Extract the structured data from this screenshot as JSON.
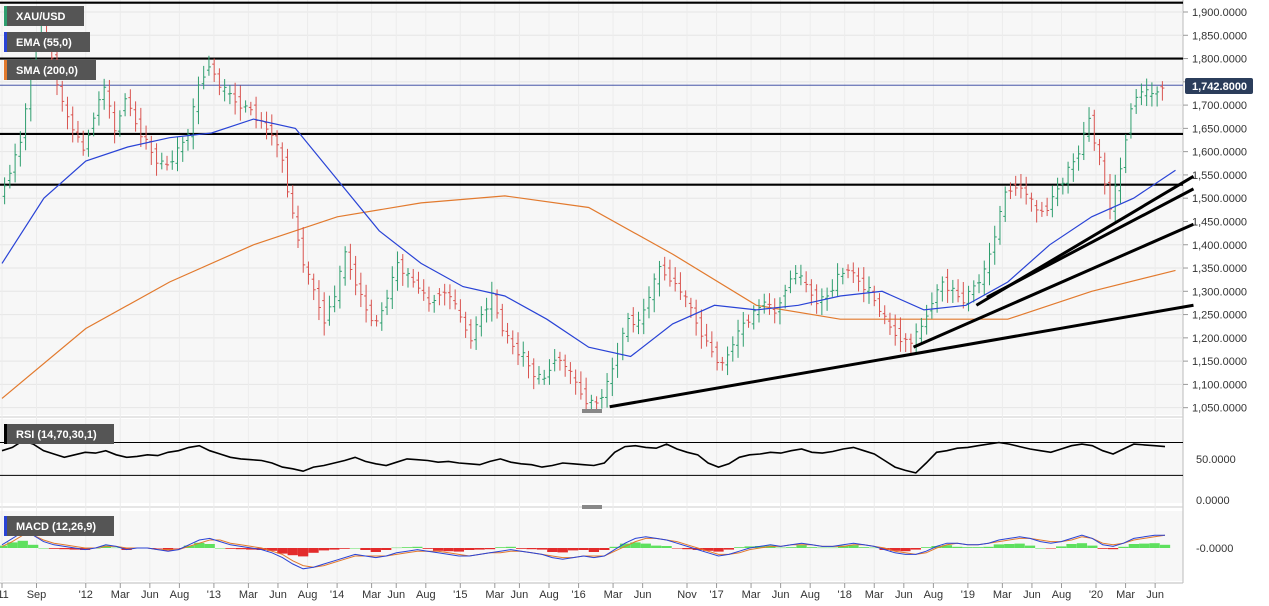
{
  "colors": {
    "up_candle": "#2e9e6e",
    "down_candle": "#d9534f",
    "ema": "#2943d6",
    "sma": "#e27a2e",
    "rsi": "#000000",
    "macd_line": "#2943d6",
    "macd_signal": "#e27a2e",
    "hist_pos": "#5ee05e",
    "hist_neg": "#e32b2b",
    "label_bg": "#555555",
    "price_tag_bg": "#2b3d5b"
  },
  "panels": {
    "price": {
      "label": "XAU/USD",
      "ema_label": "EMA (55,0)",
      "sma_label": "SMA (200,0)",
      "last_price": "1,742.8000"
    },
    "rsi": {
      "label": "RSI (14,70,30,1)"
    },
    "macd": {
      "label": "MACD (12,26,9)"
    }
  },
  "chart_data": [
    {
      "type": "candlestick",
      "title": "XAU/USD",
      "interval": "weekly",
      "y_ticks": [
        "1,900.0000",
        "1,850.0000",
        "1,800.0000",
        "1,750.0000",
        "1,700.0000",
        "1,650.0000",
        "1,600.0000",
        "1,550.0000",
        "1,500.0000",
        "1,450.0000",
        "1,400.0000",
        "1,350.0000",
        "1,300.0000",
        "1,250.0000",
        "1,200.0000",
        "1,150.0000",
        "1,100.0000",
        "1,050.0000"
      ],
      "ylim": [
        1030,
        1920
      ],
      "last_price": 1742.8,
      "x_ticks": [
        "'11",
        "Sep",
        "'12",
        "Mar",
        "Jun",
        "Aug",
        "'13",
        "Mar",
        "Jun",
        "Aug",
        "'14",
        "Mar",
        "Jun",
        "Aug",
        "'15",
        "Mar",
        "Jun",
        "Aug",
        "'16",
        "Mar",
        "Jun",
        "Nov",
        "'17",
        "Mar",
        "Jun",
        "Aug",
        "'18",
        "Mar",
        "Jun",
        "Aug",
        "'19",
        "Mar",
        "Jun",
        "Aug",
        "'20",
        "Mar",
        "Jun"
      ],
      "x_range": [
        "2011-06",
        "2020-06"
      ],
      "series": [
        {
          "name": "XAU/USD",
          "path_approx": [
            [
              0,
              1500
            ],
            [
              2,
              1560
            ],
            [
              3,
              1620
            ],
            [
              4,
              1780
            ],
            [
              5,
              1860
            ],
            [
              6,
              1800
            ],
            [
              7,
              1700
            ],
            [
              8,
              1650
            ],
            [
              9,
              1600
            ],
            [
              10,
              1680
            ],
            [
              11,
              1740
            ],
            [
              12,
              1640
            ],
            [
              13,
              1720
            ],
            [
              14,
              1660
            ],
            [
              15,
              1620
            ],
            [
              16,
              1580
            ],
            [
              17,
              1570
            ],
            [
              18,
              1600
            ],
            [
              19,
              1640
            ],
            [
              20,
              1740
            ],
            [
              21,
              1790
            ],
            [
              22,
              1740
            ],
            [
              23,
              1720
            ],
            [
              24,
              1700
            ],
            [
              25,
              1690
            ],
            [
              26,
              1660
            ],
            [
              27,
              1640
            ],
            [
              28,
              1580
            ],
            [
              29,
              1460
            ],
            [
              30,
              1360
            ],
            [
              31,
              1300
            ],
            [
              32,
              1240
            ],
            [
              33,
              1290
            ],
            [
              34,
              1380
            ],
            [
              35,
              1320
            ],
            [
              36,
              1260
            ],
            [
              37,
              1230
            ],
            [
              38,
              1290
            ],
            [
              39,
              1360
            ],
            [
              40,
              1330
            ],
            [
              41,
              1310
            ],
            [
              42,
              1270
            ],
            [
              43,
              1300
            ],
            [
              44,
              1290
            ],
            [
              45,
              1240
            ],
            [
              46,
              1200
            ],
            [
              47,
              1250
            ],
            [
              48,
              1290
            ],
            [
              49,
              1220
            ],
            [
              50,
              1180
            ],
            [
              51,
              1160
            ],
            [
              52,
              1120
            ],
            [
              53,
              1110
            ],
            [
              54,
              1160
            ],
            [
              55,
              1140
            ],
            [
              56,
              1100
            ],
            [
              57,
              1065
            ],
            [
              58,
              1060
            ],
            [
              59,
              1100
            ],
            [
              60,
              1170
            ],
            [
              61,
              1240
            ],
            [
              62,
              1230
            ],
            [
              63,
              1290
            ],
            [
              64,
              1350
            ],
            [
              65,
              1330
            ],
            [
              66,
              1300
            ],
            [
              67,
              1260
            ],
            [
              68,
              1210
            ],
            [
              69,
              1170
            ],
            [
              70,
              1140
            ],
            [
              71,
              1190
            ],
            [
              72,
              1230
            ],
            [
              73,
              1250
            ],
            [
              74,
              1280
            ],
            [
              75,
              1250
            ],
            [
              76,
              1310
            ],
            [
              77,
              1340
            ],
            [
              78,
              1310
            ],
            [
              79,
              1280
            ],
            [
              80,
              1290
            ],
            [
              81,
              1330
            ],
            [
              82,
              1350
            ],
            [
              83,
              1320
            ],
            [
              84,
              1300
            ],
            [
              85,
              1260
            ],
            [
              86,
              1220
            ],
            [
              87,
              1200
            ],
            [
              88,
              1190
            ],
            [
              89,
              1220
            ],
            [
              90,
              1280
            ],
            [
              91,
              1320
            ],
            [
              92,
              1300
            ],
            [
              93,
              1280
            ],
            [
              94,
              1310
            ],
            [
              95,
              1340
            ],
            [
              96,
              1420
            ],
            [
              97,
              1510
            ],
            [
              98,
              1530
            ],
            [
              99,
              1510
            ],
            [
              100,
              1470
            ],
            [
              101,
              1480
            ],
            [
              102,
              1520
            ],
            [
              103,
              1560
            ],
            [
              104,
              1600
            ],
            [
              105,
              1670
            ],
            [
              106,
              1580
            ],
            [
              107,
              1480
            ],
            [
              108,
              1560
            ],
            [
              109,
              1700
            ],
            [
              110,
              1730
            ],
            [
              111,
              1720
            ],
            [
              112,
              1743
            ]
          ]
        }
      ],
      "ema_label": "EMA (55,0)",
      "sma_label": "SMA (200,0)",
      "ema_approx": [
        [
          0,
          1360
        ],
        [
          4,
          1500
        ],
        [
          8,
          1580
        ],
        [
          12,
          1610
        ],
        [
          16,
          1630
        ],
        [
          20,
          1640
        ],
        [
          24,
          1670
        ],
        [
          28,
          1650
        ],
        [
          32,
          1540
        ],
        [
          36,
          1430
        ],
        [
          40,
          1360
        ],
        [
          44,
          1310
        ],
        [
          48,
          1290
        ],
        [
          52,
          1240
        ],
        [
          56,
          1180
        ],
        [
          60,
          1160
        ],
        [
          64,
          1230
        ],
        [
          68,
          1270
        ],
        [
          72,
          1260
        ],
        [
          76,
          1270
        ],
        [
          80,
          1290
        ],
        [
          84,
          1300
        ],
        [
          88,
          1260
        ],
        [
          92,
          1270
        ],
        [
          96,
          1320
        ],
        [
          100,
          1400
        ],
        [
          104,
          1460
        ],
        [
          108,
          1500
        ],
        [
          112,
          1560
        ]
      ],
      "sma_approx": [
        [
          0,
          1070
        ],
        [
          8,
          1220
        ],
        [
          16,
          1320
        ],
        [
          24,
          1400
        ],
        [
          32,
          1460
        ],
        [
          40,
          1490
        ],
        [
          48,
          1505
        ],
        [
          56,
          1480
        ],
        [
          64,
          1380
        ],
        [
          72,
          1270
        ],
        [
          80,
          1240
        ],
        [
          88,
          1240
        ],
        [
          96,
          1240
        ],
        [
          104,
          1300
        ],
        [
          112,
          1345
        ]
      ],
      "horizontal_levels": [
        1920,
        1800,
        1638,
        1529
      ],
      "trendlines": [
        {
          "from": [
            58,
            1052
          ],
          "to": [
            112,
            1270
          ]
        },
        {
          "from": [
            87,
            1180
          ],
          "to": [
            112,
            1444
          ]
        },
        {
          "from": [
            93,
            1270
          ],
          "to": [
            112,
            1547
          ]
        },
        {
          "from": [
            94,
            1287
          ],
          "to": [
            112,
            1520
          ]
        }
      ]
    },
    {
      "type": "line",
      "title": "RSI (14,70,30,1)",
      "y_ticks": [
        "50.0000",
        "0.0000"
      ],
      "ylim": [
        0,
        100
      ],
      "levels": [
        70,
        30
      ],
      "series": [
        {
          "name": "RSI (14,70,30,1)",
          "values_approx": [
            60,
            64,
            72,
            68,
            60,
            56,
            52,
            55,
            58,
            57,
            60,
            55,
            52,
            53,
            55,
            54,
            58,
            60,
            64,
            66,
            60,
            56,
            52,
            50,
            49,
            48,
            45,
            40,
            38,
            35,
            40,
            42,
            45,
            48,
            52,
            47,
            44,
            42,
            46,
            50,
            49,
            48,
            46,
            47,
            45,
            44,
            43,
            47,
            50,
            46,
            44,
            43,
            40,
            42,
            45,
            44,
            43,
            42,
            45,
            58,
            65,
            66,
            64,
            63,
            68,
            62,
            58,
            55,
            45,
            40,
            44,
            52,
            55,
            56,
            58,
            57,
            60,
            62,
            58,
            57,
            59,
            62,
            64,
            60,
            56,
            48,
            40,
            36,
            33,
            45,
            58,
            60,
            63,
            64,
            66,
            68,
            70,
            68,
            65,
            62,
            60,
            58,
            62,
            66,
            68,
            66,
            60,
            56,
            62,
            68,
            67,
            66,
            65
          ]
        }
      ]
    },
    {
      "type": "line",
      "title": "MACD (12,26,9)",
      "y_ticks": [
        "-0.0000"
      ],
      "series": [
        {
          "name": "MACD",
          "values_approx": [
            2,
            6,
            10,
            8,
            4,
            2,
            1,
            0,
            -1,
            0,
            2,
            1,
            -1,
            0,
            0,
            -1,
            -2,
            -1,
            2,
            5,
            6,
            4,
            2,
            1,
            0,
            -1,
            -3,
            -6,
            -10,
            -13,
            -12,
            -10,
            -8,
            -6,
            -4,
            -5,
            -6,
            -5,
            -3,
            -2,
            -1,
            -2,
            -3,
            -4,
            -5,
            -5,
            -4,
            -3,
            -2,
            -1,
            -2,
            -3,
            -4,
            -6,
            -7,
            -6,
            -5,
            -6,
            -5,
            -1,
            3,
            6,
            7,
            6,
            5,
            3,
            1,
            -1,
            -3,
            -5,
            -4,
            -2,
            0,
            1,
            2,
            1,
            2,
            3,
            2,
            1,
            1,
            2,
            3,
            2,
            1,
            -1,
            -3,
            -4,
            -4,
            -2,
            1,
            3,
            3,
            2,
            2,
            3,
            5,
            6,
            7,
            6,
            4,
            3,
            4,
            6,
            8,
            6,
            2,
            1,
            3,
            6,
            7,
            8,
            8
          ]
        },
        {
          "name": "Signal",
          "values_approx": [
            1,
            4,
            8,
            8,
            5,
            3,
            2,
            1,
            0,
            0,
            1,
            1,
            0,
            0,
            0,
            -1,
            -1,
            -1,
            1,
            3,
            5,
            5,
            3,
            2,
            1,
            0,
            -2,
            -4,
            -8,
            -11,
            -12,
            -11,
            -9,
            -7,
            -5,
            -5,
            -5,
            -5,
            -4,
            -3,
            -2,
            -2,
            -2,
            -3,
            -4,
            -5,
            -4,
            -3,
            -3,
            -2,
            -2,
            -3,
            -4,
            -5,
            -6,
            -6,
            -5,
            -5,
            -5,
            -2,
            1,
            4,
            6,
            6,
            5,
            4,
            2,
            0,
            -2,
            -4,
            -4,
            -3,
            -1,
            0,
            1,
            1,
            2,
            2,
            2,
            1,
            1,
            1,
            2,
            2,
            1,
            0,
            -2,
            -3,
            -4,
            -3,
            0,
            2,
            3,
            2,
            2,
            3,
            4,
            5,
            6,
            6,
            5,
            4,
            4,
            5,
            7,
            6,
            3,
            2,
            3,
            5,
            6,
            7,
            8
          ]
        }
      ]
    }
  ]
}
